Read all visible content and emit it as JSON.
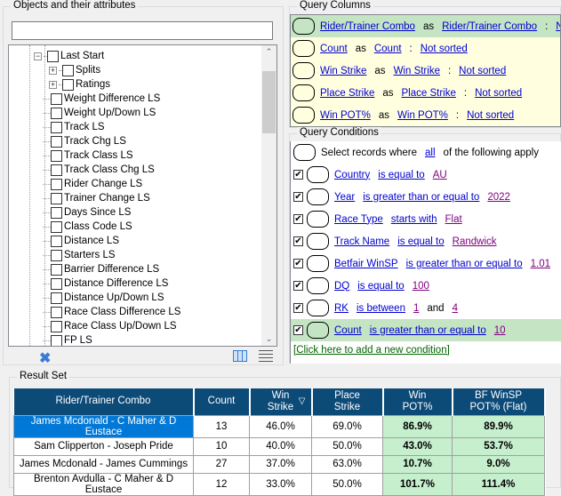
{
  "left_panel": {
    "title": "Objects and their attributes",
    "search_value": "",
    "tree": [
      {
        "label": "Last Start",
        "level": 0,
        "expander": "minus"
      },
      {
        "label": "Splits",
        "level": 1,
        "expander": "plus"
      },
      {
        "label": "Ratings",
        "level": 1,
        "expander": "plus"
      },
      {
        "label": "Weight Difference LS",
        "level": 1
      },
      {
        "label": "Weight Up/Down LS",
        "level": 1
      },
      {
        "label": "Track LS",
        "level": 1
      },
      {
        "label": "Track Chg LS",
        "level": 1
      },
      {
        "label": "Track Class LS",
        "level": 1
      },
      {
        "label": "Track Class Chg LS",
        "level": 1
      },
      {
        "label": "Rider Change LS",
        "level": 1
      },
      {
        "label": "Trainer Change LS",
        "level": 1
      },
      {
        "label": "Days Since LS",
        "level": 1
      },
      {
        "label": "Class Code LS",
        "level": 1
      },
      {
        "label": "Distance LS",
        "level": 1
      },
      {
        "label": "Starters LS",
        "level": 1
      },
      {
        "label": "Barrier Difference LS",
        "level": 1
      },
      {
        "label": "Distance Difference LS",
        "level": 1
      },
      {
        "label": "Distance Up/Down LS",
        "level": 1
      },
      {
        "label": "Race Class Difference LS",
        "level": 1
      },
      {
        "label": "Race Class Up/Down LS",
        "level": 1
      },
      {
        "label": "FP LS",
        "level": 1
      }
    ]
  },
  "query_columns": {
    "title": "Query Columns",
    "as_label": "as",
    "rows": [
      {
        "field": "Rider/Trainer Combo",
        "alias": "Rider/Trainer Combo",
        "sort": "Not sorted",
        "selected": true
      },
      {
        "field": "Count",
        "alias": "Count",
        "sort": "Not sorted"
      },
      {
        "field": "Win Strike",
        "alias": "Win Strike",
        "sort": "Not sorted"
      },
      {
        "field": "Place Strike",
        "alias": "Place Strike",
        "sort": "Not sorted"
      },
      {
        "field": "Win POT%",
        "alias": "Win POT%",
        "sort": "Not sorted"
      }
    ]
  },
  "query_conditions": {
    "title": "Query Conditions",
    "header_prefix": "Select records where",
    "header_mode": "all",
    "header_suffix": "of the following apply",
    "rows": [
      {
        "field": "Country",
        "op": "is equal to",
        "values": [
          "AU"
        ],
        "checked": true
      },
      {
        "field": "Year",
        "op": "is greater than or equal to",
        "values": [
          "2022"
        ],
        "checked": true
      },
      {
        "field": "Race Type",
        "op": "starts with",
        "values": [
          "Flat"
        ],
        "checked": true
      },
      {
        "field": "Track Name",
        "op": "is equal to",
        "values": [
          "Randwick"
        ],
        "checked": true
      },
      {
        "field": "Betfair WinSP",
        "op": "is greater than or equal to",
        "values": [
          "1.01"
        ],
        "checked": true
      },
      {
        "field": "DQ",
        "op": "is equal to",
        "values": [
          "100"
        ],
        "checked": true
      },
      {
        "field": "RK",
        "op": "is between",
        "values": [
          "1",
          "4"
        ],
        "joiner": "and",
        "checked": true
      },
      {
        "field": "Count",
        "op": "is greater than or equal to",
        "values": [
          "10"
        ],
        "checked": true,
        "selected": true
      }
    ],
    "add_link": "[Click here to add a new condition]"
  },
  "result_set": {
    "title": "Result Set",
    "columns": [
      "Rider/Trainer Combo",
      "Count",
      "Win\nStrike",
      "Place\nStrike",
      "Win\nPOT%",
      "BF WinSP\nPOT% (Flat)"
    ],
    "sorted_column_index": 2,
    "rows": [
      [
        "James Mcdonald - C Maher & D Eustace",
        "13",
        "46.0%",
        "69.0%",
        "86.9%",
        "89.9%"
      ],
      [
        "Sam Clipperton - Joseph Pride",
        "10",
        "40.0%",
        "50.0%",
        "43.0%",
        "53.7%"
      ],
      [
        "James Mcdonald - James Cummings",
        "27",
        "37.0%",
        "63.0%",
        "10.7%",
        "9.0%"
      ],
      [
        "Brenton Avdulla - C Maher & D Eustace",
        "12",
        "33.0%",
        "50.0%",
        "101.7%",
        "111.4%"
      ]
    ],
    "selected_row": 0
  },
  "colors": {
    "header_bg": "#0c4a78",
    "highlight": "#c6efce",
    "selection": "#0078d7",
    "columns_bg": "#ffffe0"
  }
}
